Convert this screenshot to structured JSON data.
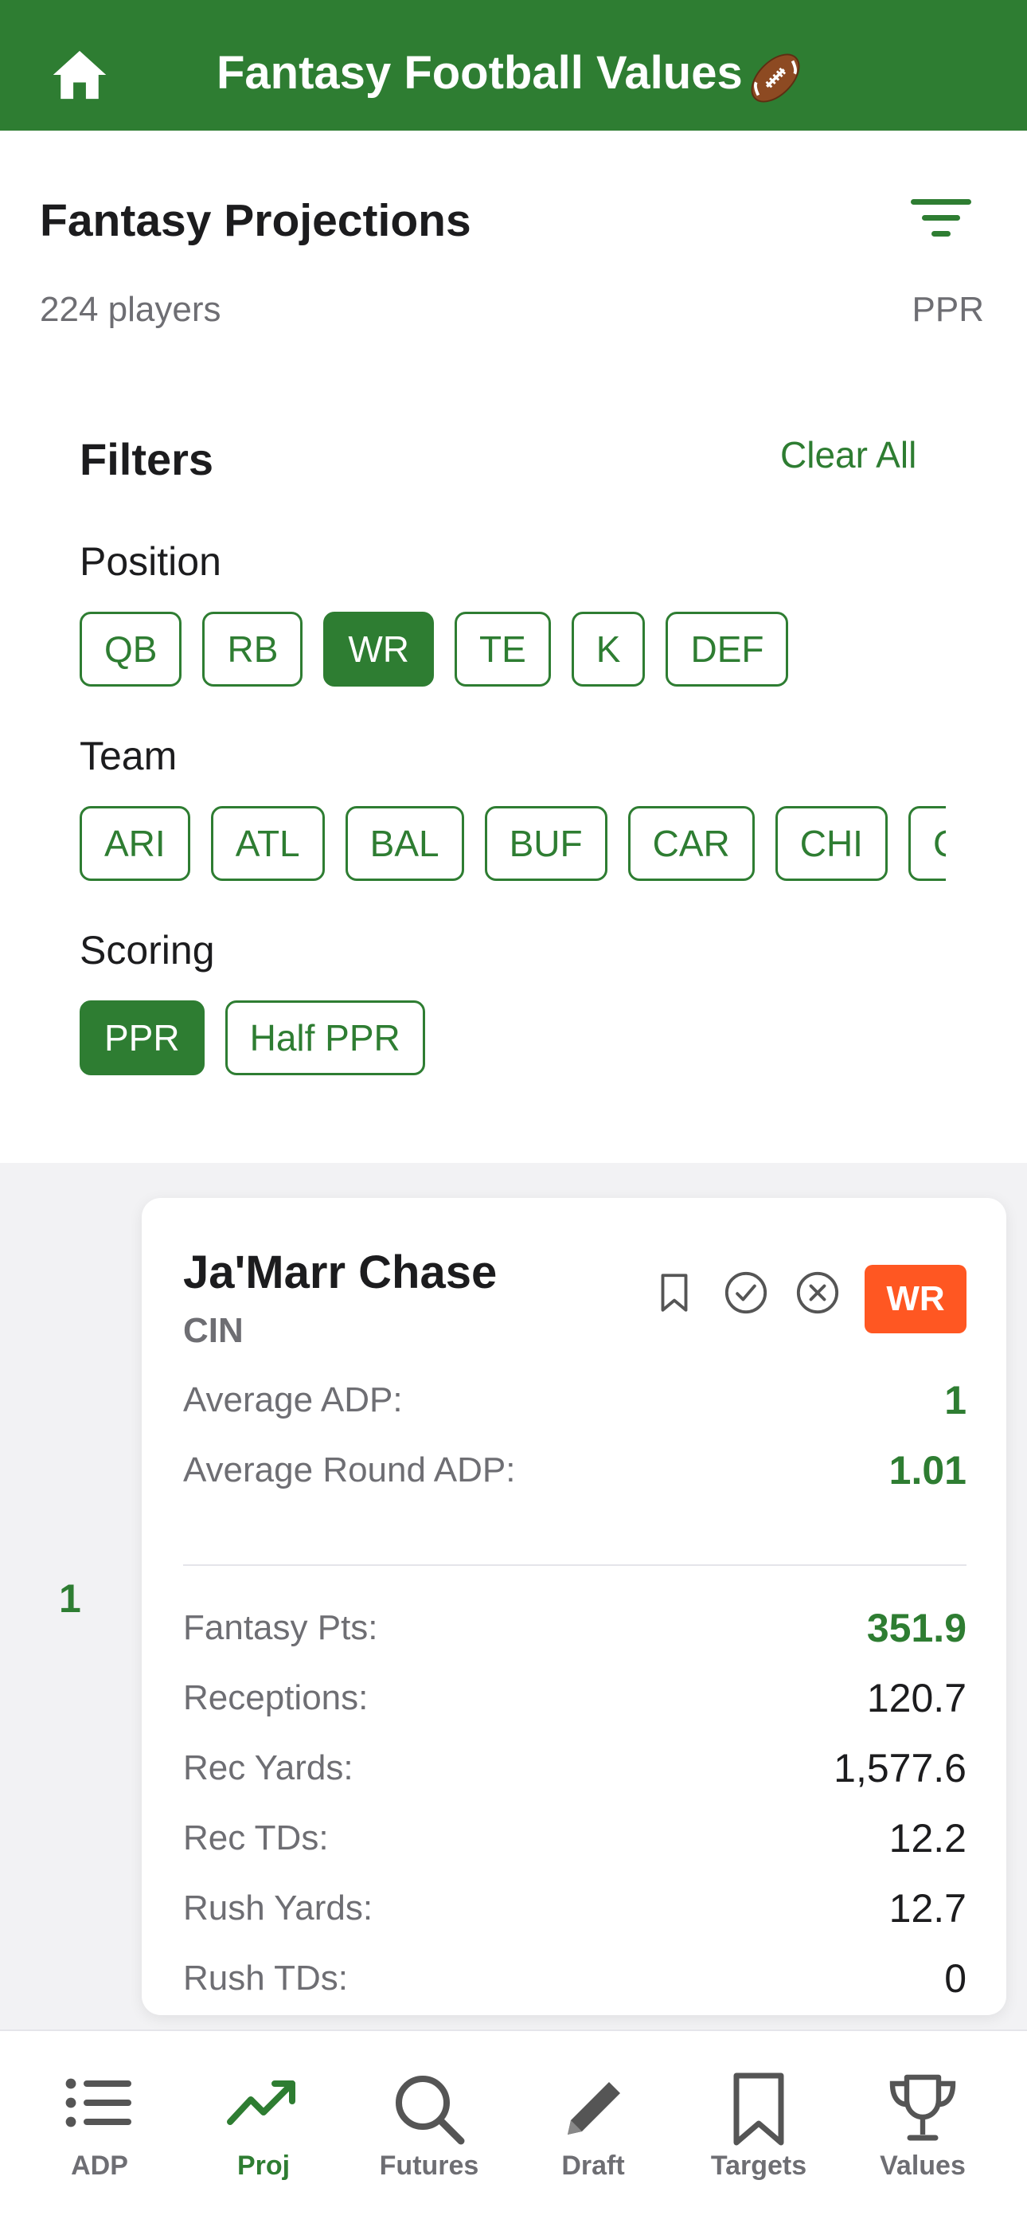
{
  "header": {
    "title": "Fantasy Football Values",
    "home_icon": "home-icon",
    "emoji_icon": "american-football-icon"
  },
  "page": {
    "title": "Fantasy Projections",
    "player_count": "224 players",
    "scoring": "PPR"
  },
  "filters": {
    "title": "Filters",
    "clear_all": "Clear All",
    "position": {
      "label": "Position",
      "options": [
        "QB",
        "RB",
        "WR",
        "TE",
        "K",
        "DEF"
      ],
      "selected": "WR"
    },
    "team": {
      "label": "Team",
      "options": [
        "ARI",
        "ATL",
        "BAL",
        "BUF",
        "CAR",
        "CHI",
        "CIN"
      ]
    },
    "scoring": {
      "label": "Scoring",
      "options": [
        "PPR",
        "Half PPR"
      ],
      "selected": "PPR"
    }
  },
  "players": [
    {
      "rank": "1",
      "name": "Ja'Marr Chase",
      "team": "CIN",
      "position": "WR",
      "adp": [
        {
          "label": "Average ADP:",
          "value": "1"
        },
        {
          "label": "Average Round ADP:",
          "value": "1.01"
        }
      ],
      "stats": [
        {
          "label": "Fantasy Pts:",
          "value": "351.9"
        },
        {
          "label": "Receptions:",
          "value": "120.7"
        },
        {
          "label": "Rec Yards:",
          "value": "1,577.6"
        },
        {
          "label": "Rec TDs:",
          "value": "12.2"
        },
        {
          "label": "Rush Yards:",
          "value": "12.7"
        },
        {
          "label": "Rush TDs:",
          "value": "0"
        }
      ]
    }
  ],
  "tabs": [
    {
      "label": "ADP",
      "icon": "list-icon"
    },
    {
      "label": "Proj",
      "icon": "trending-up-icon",
      "active": true
    },
    {
      "label": "Futures",
      "icon": "search-icon"
    },
    {
      "label": "Draft",
      "icon": "pencil-icon"
    },
    {
      "label": "Targets",
      "icon": "bookmark-icon"
    },
    {
      "label": "Values",
      "icon": "trophy-icon"
    }
  ],
  "colors": {
    "brand": "#2e7d32",
    "badge_wr": "#ff5722"
  }
}
